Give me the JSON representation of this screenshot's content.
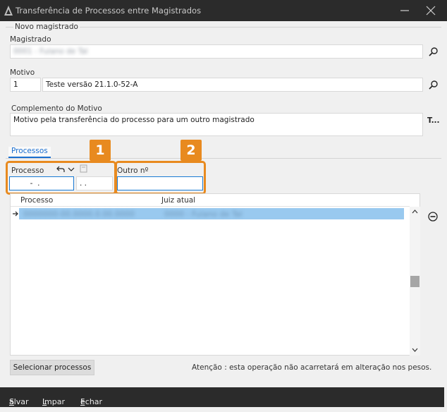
{
  "window": {
    "title": "Transferência de Processos entre Magistrados"
  },
  "group": {
    "legend": "Novo magistrado"
  },
  "magistrado": {
    "label": "Magistrado",
    "value": "0001 - Fulano de Tal"
  },
  "motivo": {
    "label": "Motivo",
    "code": "1",
    "description": "Teste versão 21.1.0-52-A"
  },
  "complemento": {
    "label": "Complemento do Motivo",
    "value": "Motivo pela transferência do processo para um outro magistrado",
    "more_button": "T..."
  },
  "tabs": {
    "processos": "Processos"
  },
  "filters": {
    "processo_label": "Processo",
    "processo_value": "  -  .",
    "processo_suffix": ". .",
    "outro_label": "Outro nº",
    "outro_value": ""
  },
  "badges": {
    "one": "1",
    "two": "2"
  },
  "grid": {
    "columns": [
      "Processo",
      "Juiz atual"
    ],
    "rows": [
      {
        "processo": "0000000-00.0000.0.00.0000",
        "juiz": "0000 - Fulano de Tal"
      }
    ]
  },
  "actions": {
    "select": "Selecionar processos",
    "warning": "Atenção : esta operação não acarretará em alteração nos pesos."
  },
  "footer": {
    "save": "Salvar",
    "clear": "Limpar",
    "close": "Fechar"
  },
  "colors": {
    "accent": "#1a6fd0",
    "highlight": "#e88a1f",
    "selection": "#99c9ef"
  }
}
